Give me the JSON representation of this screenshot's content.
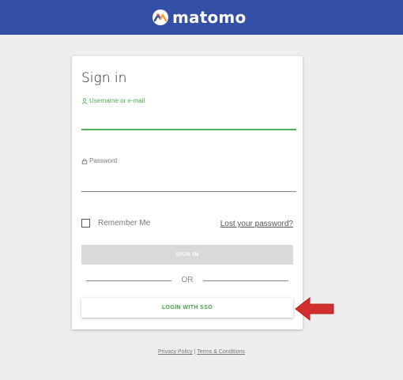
{
  "brand": {
    "name": "matomo"
  },
  "login": {
    "title": "Sign in",
    "username_label": "Username or e-mail",
    "username_value": "",
    "password_label": "Password",
    "password_value": "",
    "remember_label": "Remember Me",
    "remember_checked": false,
    "lost_password": "Lost your password?",
    "signin_button": "SIGN IN",
    "or_text": "OR",
    "sso_button": "LOGIN WITH SSO"
  },
  "footer": {
    "privacy": "Privacy Policy",
    "separator": "|",
    "terms": "Terms & Conditions"
  },
  "colors": {
    "header": "#3350a6",
    "accent_green": "#4caf50",
    "arrow_red": "#d32f2f"
  },
  "icons": {
    "username": "user-icon",
    "password": "lock-icon",
    "annotation": "red-arrow-icon"
  }
}
